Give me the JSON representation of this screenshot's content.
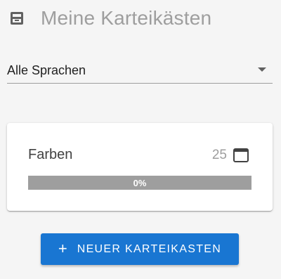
{
  "header": {
    "title": "Meine Karteikästen",
    "icon": "inbox-tray-icon"
  },
  "filter": {
    "selected": "Alle Sprachen"
  },
  "cards": [
    {
      "name": "Farben",
      "count": "25",
      "icon": "card-box-icon",
      "progress_label": "0%",
      "progress_value": 0
    }
  ],
  "actions": {
    "add_label": "NEUER KARTEIKASTEN",
    "add_icon": "plus-icon"
  },
  "colors": {
    "primary": "#1976d2",
    "muted_text": "#9e9e9e",
    "progress_track": "#9e9e9e",
    "background": "#f5f5f5"
  }
}
